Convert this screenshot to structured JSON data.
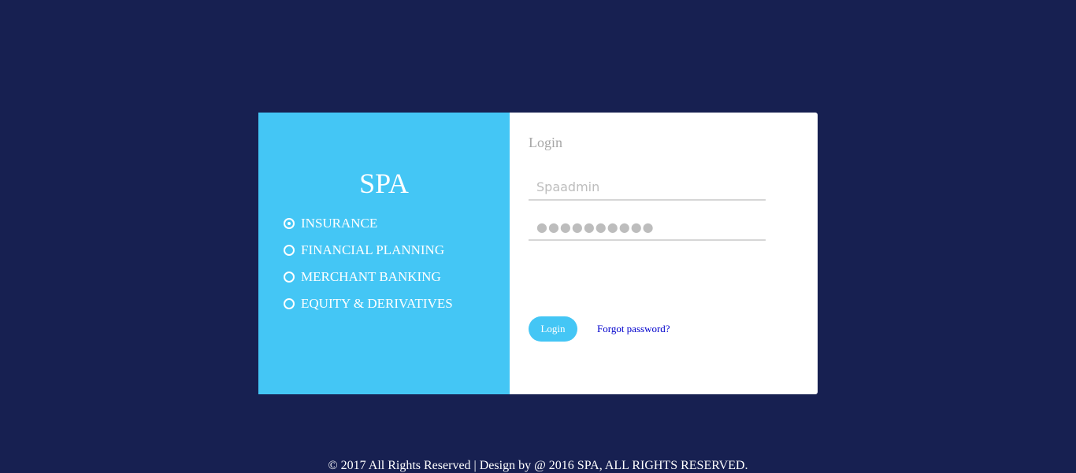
{
  "brand": {
    "name": "SPA"
  },
  "services": {
    "items": [
      {
        "label": "INSURANCE",
        "checked": true
      },
      {
        "label": "FINANCIAL PLANNING",
        "checked": false
      },
      {
        "label": "MERCHANT BANKING",
        "checked": false
      },
      {
        "label": "EQUITY & DERIVATIVES",
        "checked": false
      }
    ]
  },
  "login": {
    "title": "Login",
    "username_placeholder": "Spaadmin",
    "password_value": "●●●●●●●●●●",
    "button_label": "Login",
    "forgot_label": "Forgot password?"
  },
  "footer": {
    "text": "© 2017 All Rights Reserved | Design by @ 2016 SPA, ALL RIGHTS RESERVED."
  },
  "colors": {
    "background": "#172051",
    "accent": "#44c6f5",
    "panel": "#ffffff",
    "link": "#0000cc"
  }
}
